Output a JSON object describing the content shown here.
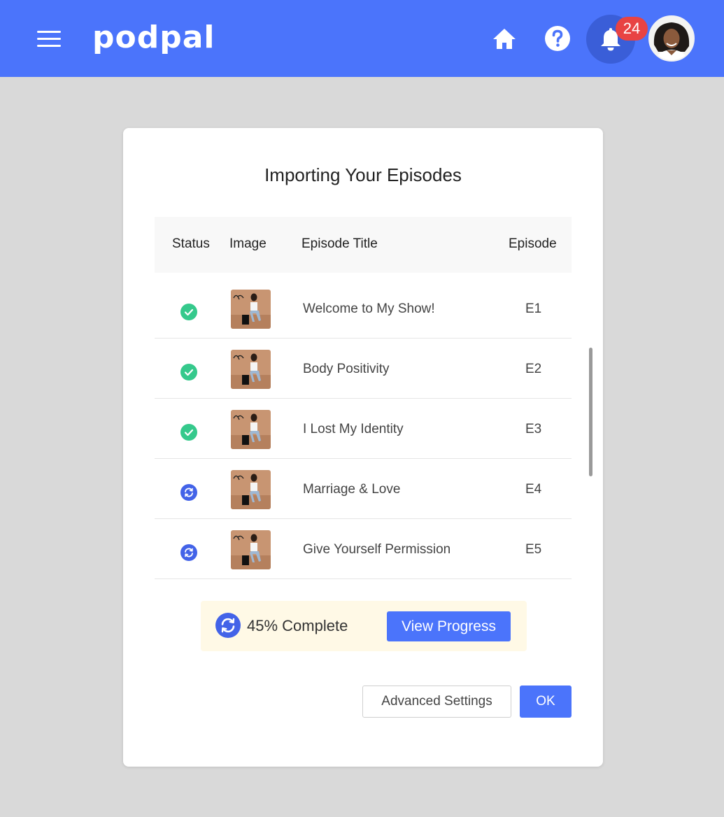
{
  "app": {
    "logo_text": "podpal"
  },
  "header": {
    "icons": [
      "menu-icon",
      "home-icon",
      "help-icon",
      "bell-icon"
    ],
    "notification_count": "24",
    "colors": {
      "bar": "#4b74fb",
      "badge": "#e84343"
    }
  },
  "dialog": {
    "title": "Importing Your Episodes",
    "columns": [
      "Status",
      "Image",
      "Episode Title",
      "Episode"
    ],
    "episodes": [
      {
        "status": "complete",
        "status_icon": "check-icon",
        "title": "Welcome to My Show!",
        "number": "E1"
      },
      {
        "status": "complete",
        "status_icon": "check-icon",
        "title": "Body Positivity",
        "number": "E2"
      },
      {
        "status": "complete",
        "status_icon": "check-icon",
        "title": "I Lost My Identity",
        "number": "E3"
      },
      {
        "status": "syncing",
        "status_icon": "sync-icon",
        "title": "Marriage & Love",
        "number": "E4"
      },
      {
        "status": "syncing",
        "status_icon": "sync-icon",
        "title": "Give Yourself Permission",
        "number": "E5"
      }
    ],
    "progress": {
      "percent": 45,
      "text": "45% Complete",
      "button_label": "View Progress"
    },
    "buttons": {
      "advanced_label": "Advanced Settings",
      "ok_label": "OK"
    },
    "colors": {
      "complete": "#35c98c",
      "syncing": "#4363e8",
      "progress_bg": "#fff9e6"
    }
  }
}
